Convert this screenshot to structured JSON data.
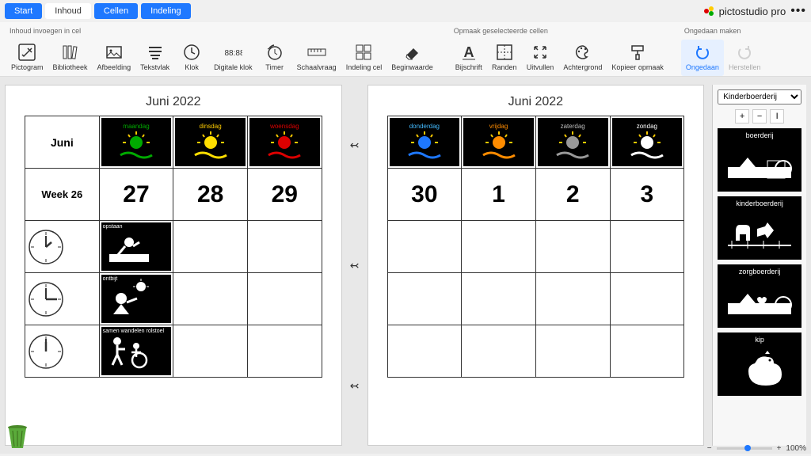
{
  "brand": {
    "name": "pictostudio pro"
  },
  "tabs": [
    {
      "label": "Start"
    },
    {
      "label": "Inhoud"
    },
    {
      "label": "Cellen"
    },
    {
      "label": "Indeling"
    }
  ],
  "toolbar": {
    "group1_label": "Inhoud invoegen in cel",
    "group2_label": "Opmaak geselecteerde cellen",
    "group3_label": "Ongedaan maken",
    "items": {
      "pictogram": "Pictogram",
      "bibliotheek": "Bibliotheek",
      "afbeelding": "Afbeelding",
      "tekstvlak": "Tekstvlak",
      "klok": "Klok",
      "digitale_klok": "Digitale klok",
      "timer": "Timer",
      "schaalvraag": "Schaalvraag",
      "indeling_cel": "Indeling cel",
      "beginwaarde": "Beginwaarde",
      "bijschrift": "Bijschrift",
      "randen": "Randen",
      "uitvullen": "Uitvullen",
      "achtergrond": "Achtergrond",
      "kopieer_opmaak": "Kopieer opmaak",
      "ongedaan": "Ongedaan",
      "herstellen": "Herstellen"
    }
  },
  "pages": {
    "left": {
      "title": "Juni 2022",
      "header": "Juni",
      "week": "Week 26",
      "days": [
        {
          "name": "maandag",
          "num": "27",
          "sun": "#0a0",
          "wave": "#0a0"
        },
        {
          "name": "dinsdag",
          "num": "28",
          "sun": "#ffde00",
          "wave": "#ffde00"
        },
        {
          "name": "woensdag",
          "num": "29",
          "sun": "#d00",
          "wave": "#d00"
        }
      ],
      "activities": [
        {
          "label": "opstaan"
        },
        {
          "label": "ontbijt"
        },
        {
          "label": "samen wandelen rolstoel"
        }
      ]
    },
    "right": {
      "title": "Juni 2022",
      "days": [
        {
          "name": "donderdag",
          "num": "30",
          "sun": "#1e78ff",
          "wave": "#1e78ff"
        },
        {
          "name": "vrijdag",
          "num": "1",
          "sun": "#ff8c00",
          "wave": "#ff8c00"
        },
        {
          "name": "zaterdag",
          "num": "2",
          "sun": "#999",
          "wave": "#999"
        },
        {
          "name": "zondag",
          "num": "3",
          "sun": "#fff",
          "wave": "#fff",
          "white": true
        }
      ]
    }
  },
  "right_panel": {
    "selected": "Kinderboerderij",
    "items": [
      {
        "label": "boerderij"
      },
      {
        "label": "kinderboerderij"
      },
      {
        "label": "zorgboerderij"
      },
      {
        "label": "kip"
      }
    ]
  },
  "zoom": {
    "value": "100%"
  }
}
